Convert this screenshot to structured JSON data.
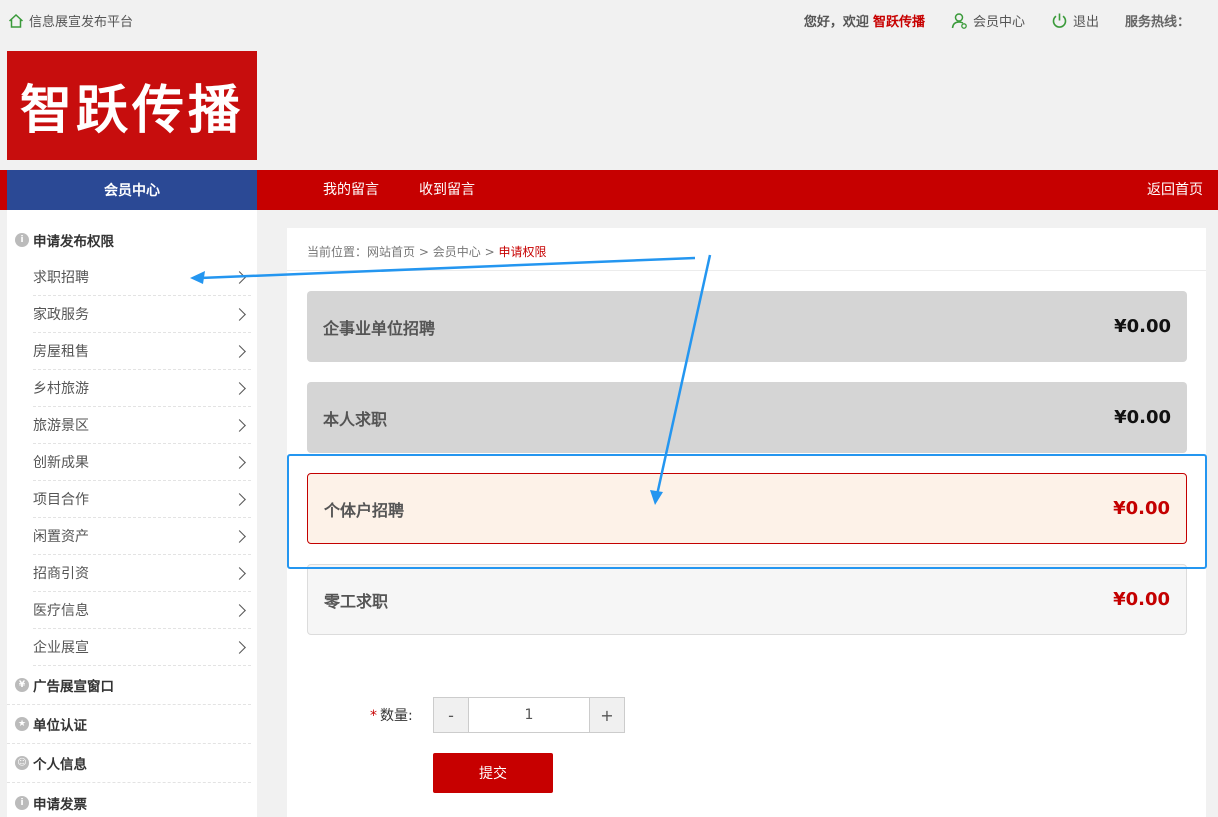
{
  "topbar": {
    "platform": "信息展宣发布平台",
    "greeting": "您好，欢迎",
    "username": "智跃传播",
    "member_center": "会员中心",
    "logout": "退出",
    "hotline": "服务热线："
  },
  "logo": {
    "text": "智跃传播",
    "bg_color": "#c70d0d"
  },
  "nav": {
    "member_center": "会员中心",
    "my_messages": "我的留言",
    "received_messages": "收到留言",
    "back_home": "返回首页",
    "bar_color": "#c60000",
    "member_color": "#2b4995"
  },
  "sidebar": {
    "apply_publish": "申请发布权限",
    "items": [
      "求职招聘",
      "家政服务",
      "房屋租售",
      "乡村旅游",
      "旅游景区",
      "创新成果",
      "项目合作",
      "闲置资产",
      "招商引资",
      "医疗信息",
      "企业展宣"
    ],
    "ad_window": "广告展宣窗口",
    "unit_cert": "单位认证",
    "personal_info": "个人信息",
    "apply_invoice": "申请发票"
  },
  "breadcrumb": {
    "prefix": "当前位置：",
    "home": "网站首页",
    "sep": ">",
    "member": "会员中心",
    "current": "申请权限"
  },
  "options": [
    {
      "name": "企事业单位招聘",
      "price": "¥0.00",
      "state": "disabled"
    },
    {
      "name": "本人求职",
      "price": "¥0.00",
      "state": "disabled"
    },
    {
      "name": "个体户招聘",
      "price": "¥0.00",
      "state": "selected"
    },
    {
      "name": "零工求职",
      "price": "¥0.00",
      "state": "normal"
    }
  ],
  "quantity": {
    "star": "*",
    "label": "数量:",
    "minus": "-",
    "value": "1",
    "plus": "+"
  },
  "submit_label": "提交",
  "colors": {
    "accent_red": "#c70000",
    "highlight_blue": "#2496f0"
  }
}
